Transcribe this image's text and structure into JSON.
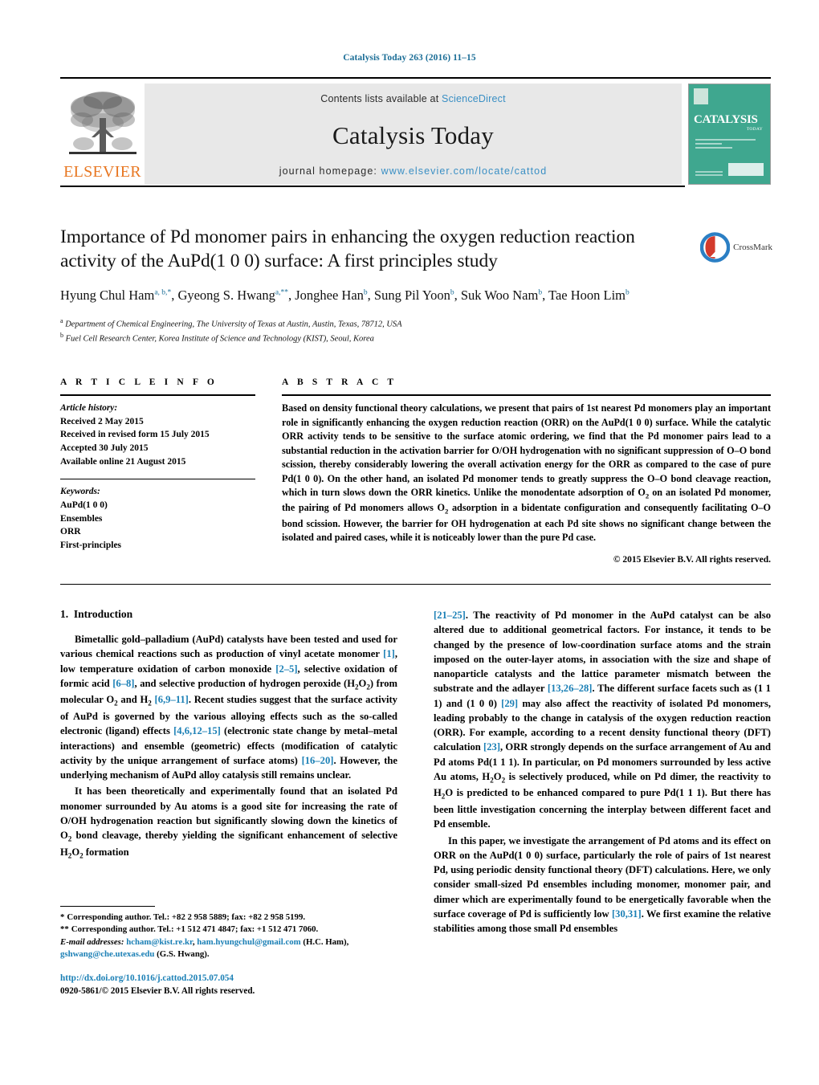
{
  "running_head": "Catalysis Today 263 (2016) 11–15",
  "masthead": {
    "publisher_name": "ELSEVIER",
    "contents_prefix": "Contents lists available at ",
    "contents_link": "ScienceDirect",
    "journal_name": "Catalysis Today",
    "homepage_prefix": "journal homepage: ",
    "homepage_url": "www.elsevier.com/locate/cattod",
    "cover_title": "CATALYSIS",
    "cover_subtitle": "TODAY"
  },
  "article": {
    "title": "Importance of Pd monomer pairs in enhancing the oxygen reduction reaction activity of the AuPd(1 0 0) surface: A first principles study",
    "crossmark_label": "CrossMark",
    "authors_html": "Hyung Chul Ham<sup class=\"aff\">a, b,</sup><sup class=\"star\">*</sup>, Gyeong S. Hwang<sup class=\"aff\">a,</sup><sup class=\"star\">**</sup>, Jonghee Han<sup class=\"aff\">b</sup>, Sung Pil Yoon<sup class=\"aff\">b</sup>, Suk Woo Nam<sup class=\"aff\">b</sup>, Tae Hoon Lim<sup class=\"aff\">b</sup>",
    "affiliation_a": "Department of Chemical Engineering, The University of Texas at Austin, Austin, Texas, 78712, USA",
    "affiliation_b": "Fuel Cell Research Center, Korea Institute of Science and Technology (KIST), Seoul, Korea"
  },
  "article_info": {
    "heading": "A R T I C L E   I N F O",
    "history_label": "Article history:",
    "history": [
      "Received 2 May 2015",
      "Received in revised form 15 July 2015",
      "Accepted 30 July 2015",
      "Available online 21 August 2015"
    ],
    "keywords_label": "Keywords:",
    "keywords": [
      "AuPd(1 0 0)",
      "Ensembles",
      "ORR",
      "First-principles"
    ]
  },
  "abstract": {
    "heading": "A B S T R A C T",
    "body": "Based on density functional theory calculations, we present that pairs of 1st nearest Pd monomers play an important role in significantly enhancing the oxygen reduction reaction (ORR) on the AuPd(1 0 0) surface. While the catalytic ORR activity tends to be sensitive to the surface atomic ordering, we find that the Pd monomer pairs lead to a substantial reduction in the activation barrier for O/OH hydrogenation with no significant suppression of O–O bond scission, thereby considerably lowering the overall activation energy for the ORR as compared to the case of pure Pd(1 0 0). On the other hand, an isolated Pd monomer tends to greatly suppress the O–O bond cleavage reaction, which in turn slows down the ORR kinetics. Unlike the monodentate adsorption of O2 on an isolated Pd monomer, the pairing of Pd monomers allows O2 adsorption in a bidentate configuration and consequently facilitating O–O bond scission. However, the barrier for OH hydrogenation at each Pd site shows no significant change between the isolated and paired cases, while it is noticeably lower than the pure Pd case.",
    "copyright": "© 2015 Elsevier B.V. All rights reserved."
  },
  "introduction": {
    "section_number": "1.",
    "section_title": "Introduction",
    "left_para_1": "Bimetallic gold–palladium (AuPd) catalysts have been tested and used for various chemical reactions such as production of vinyl acetate monomer [1], low temperature oxidation of carbon monoxide [2–5], selective oxidation of formic acid [6–8], and selective production of hydrogen peroxide (H2O2) from molecular O2 and H2 [6,9–11]. Recent studies suggest that the surface activity of AuPd is governed by the various alloying effects such as the so-called electronic (ligand) effects [4,6,12–15] (electronic state change by metal–metal interactions) and ensemble (geometric) effects (modification of catalytic activity by the unique arrangement of surface atoms) [16–20]. However, the underlying mechanism of AuPd alloy catalysis still remains unclear.",
    "left_para_2": "It has been theoretically and experimentally found that an isolated Pd monomer surrounded by Au atoms is a good site for increasing the rate of O/OH hydrogenation reaction but significantly slowing down the kinetics of O2 bond cleavage, thereby yielding the significant enhancement of selective H2O2 formation",
    "right_para_1": "[21–25]. The reactivity of Pd monomer in the AuPd catalyst can be also altered due to additional geometrical factors. For instance, it tends to be changed by the presence of low-coordination surface atoms and the strain imposed on the outer-layer atoms, in association with the size and shape of nanoparticle catalysts and the lattice parameter mismatch between the substrate and the adlayer [13,26–28]. The different surface facets such as (1 1 1) and (1 0 0) [29] may also affect the reactivity of isolated Pd monomers, leading probably to the change in catalysis of the oxygen reduction reaction (ORR). For example, according to a recent density functional theory (DFT) calculation [23], ORR strongly depends on the surface arrangement of Au and Pd atoms Pd(1 1 1). In particular, on Pd monomers surrounded by less active Au atoms, H2O2 is selectively produced, while on Pd dimer, the reactivity to H2O is predicted to be enhanced compared to pure Pd(1 1 1). But there has been little investigation concerning the interplay between different facet and Pd ensemble.",
    "right_para_2": "In this paper, we investigate the arrangement of Pd atoms and its effect on ORR on the AuPd(1 0 0) surface, particularly the role of pairs of 1st nearest Pd, using periodic density functional theory (DFT) calculations. Here, we only consider small-sized Pd ensembles including monomer, monomer pair, and dimer which are experimentally found to be energetically favorable when the surface coverage of Pd is sufficiently low [30,31]. We first examine the relative stabilities among those small Pd ensembles"
  },
  "footnotes": {
    "line1_marker": "*",
    "line1": "Corresponding author. Tel.: +82 2 958 5889; fax: +82 2 958 5199.",
    "line2_marker": "**",
    "line2": "Corresponding author. Tel.: +1 512 471 4847; fax: +1 512 471 7060.",
    "email_label": "E-mail addresses:",
    "email1": "hcham@kist.re.kr",
    "email2": "ham.hyungchul@gmail.com",
    "email_owner1": "(H.C. Ham)",
    "email3": "gshwang@che.utexas.edu",
    "email_owner2": "(G.S. Hwang).",
    "doi": "http://dx.doi.org/10.1016/j.cattod.2015.07.054",
    "issn": "0920-5861/© 2015 Elsevier B.V. All rights reserved."
  },
  "colors": {
    "link_blue": "#1a7fb5",
    "header_blue": "#1a6d96",
    "elsevier_orange": "#E87722",
    "cover_green": "#3fa78f",
    "masthead_gray": "#e8e8e8"
  }
}
